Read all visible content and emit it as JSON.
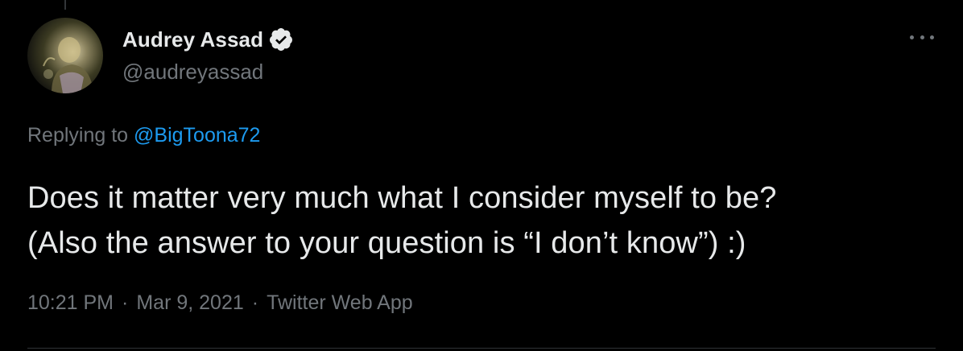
{
  "author": {
    "display_name": "Audrey Assad",
    "handle": "@audreyassad",
    "verified": true,
    "avatar_icon": "profile-photo"
  },
  "reply": {
    "prefix": "Replying to",
    "mention": "@BigToona72"
  },
  "tweet": {
    "line1": "Does it matter very much what I consider myself to be?",
    "line2": "(Also the answer to your question is “I don’t know”) :)"
  },
  "meta": {
    "time": "10:21 PM",
    "separator": "·",
    "date": "Mar 9, 2021",
    "source": "Twitter Web App"
  },
  "icons": {
    "verified": "verified-badge-icon",
    "more": "more-horizontal-icon"
  },
  "colors": {
    "background": "#000000",
    "text": "#e7e9ea",
    "secondary": "#71767b",
    "link": "#1d9bf0"
  }
}
